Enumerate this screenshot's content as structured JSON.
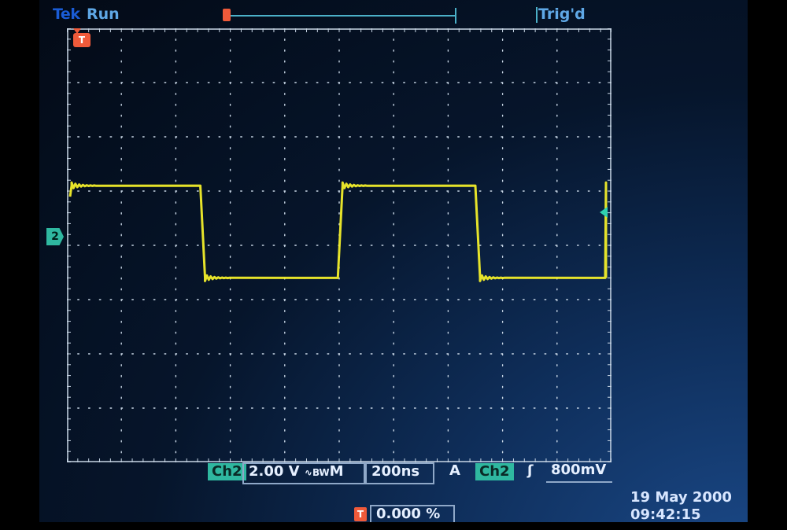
{
  "header": {
    "brand": "Tek",
    "run_state": "Run",
    "trigger_state": "Trig'd"
  },
  "markers": {
    "trigger": "T",
    "channel": "2"
  },
  "status_bar": {
    "channel_label": "Ch2",
    "volts_per_div": "2.00 V",
    "coupling_bw": "∿BW",
    "timebase_prefix": "M",
    "time_per_div": "200ns",
    "trigger_source_prefix": "A",
    "trigger_channel": "Ch2",
    "trigger_slope": "ʃ",
    "trigger_level": "800mV"
  },
  "footer": {
    "trigger_position_marker": "T",
    "trigger_position": "0.000 %",
    "date": "19 May 2000",
    "time": "09:42:15"
  },
  "waveform": {
    "color": "#f2ee2a",
    "high_level_div": 1.0,
    "low_level_div": -0.7,
    "period_div": 5.05,
    "first_fall_div": 2.45
  },
  "colors": {
    "grid": "#c9d7e6",
    "trace": "#f2ee2a",
    "channel": "#2fb8a0",
    "trigger": "#ef5a3a"
  }
}
